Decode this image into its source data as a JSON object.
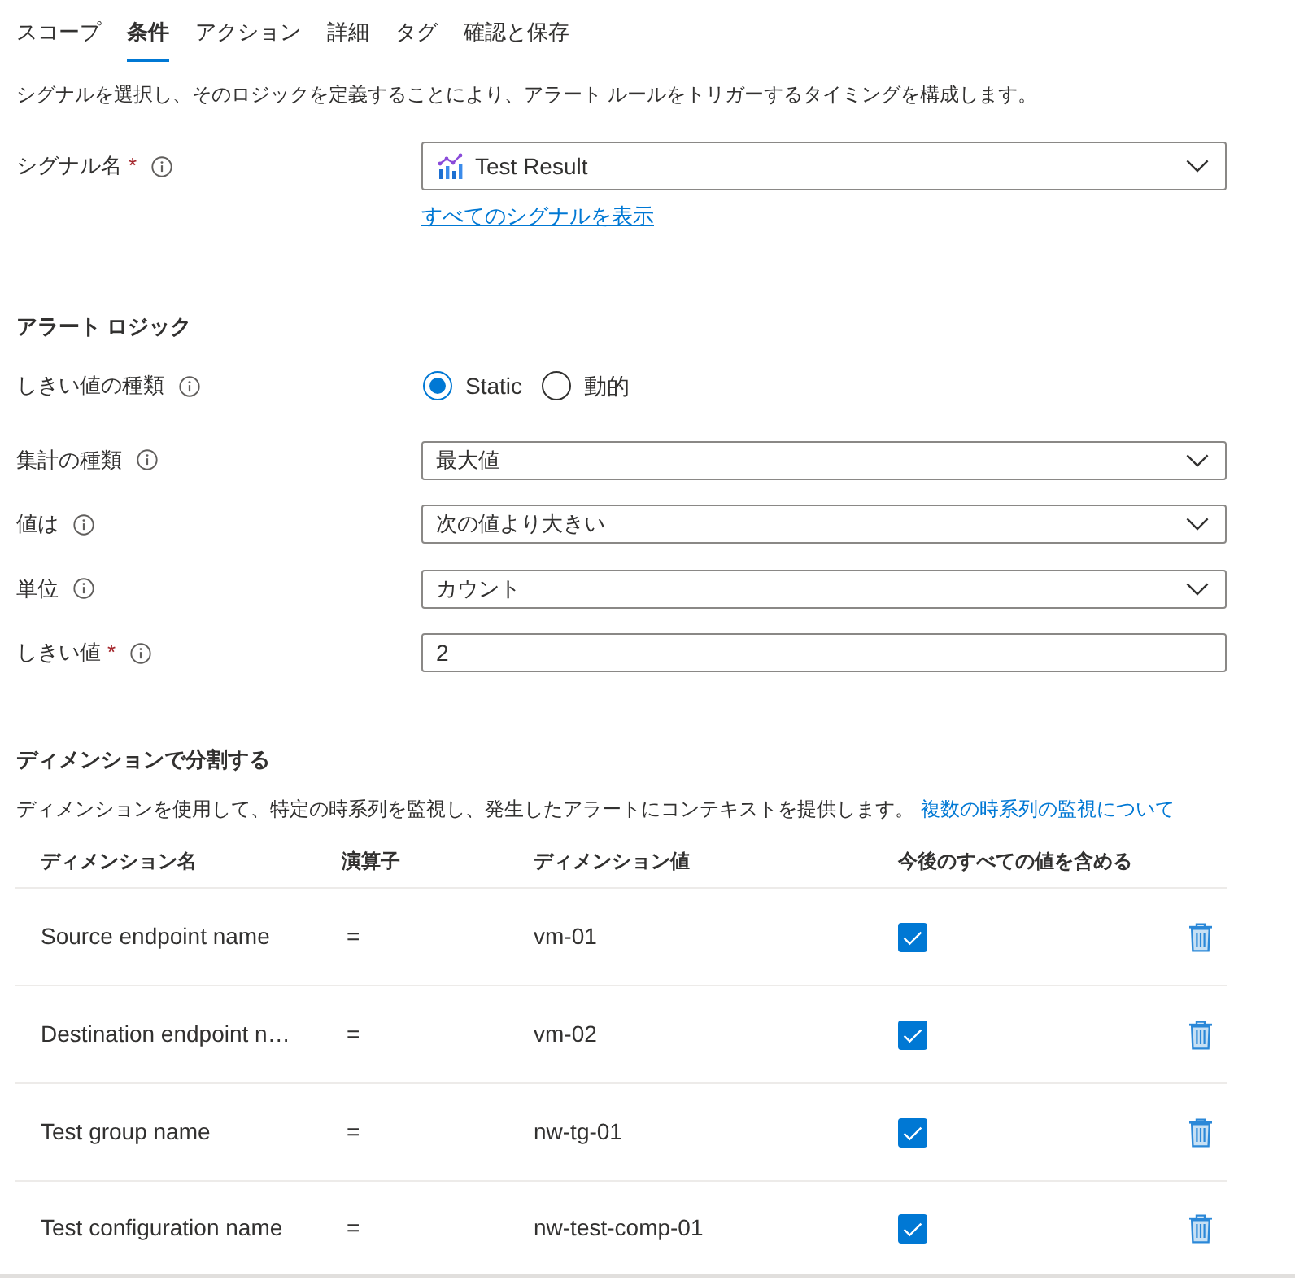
{
  "tabs": [
    {
      "label": "スコープ",
      "selected": false
    },
    {
      "label": "条件",
      "selected": true
    },
    {
      "label": "アクション",
      "selected": false
    },
    {
      "label": "詳細",
      "selected": false
    },
    {
      "label": "タグ",
      "selected": false
    },
    {
      "label": "確認と保存",
      "selected": false
    }
  ],
  "description": "シグナルを選択し、そのロジックを定義することにより、アラート ルールをトリガーするタイミングを構成します。",
  "signal": {
    "label": "シグナル名",
    "required_mark": "*",
    "value": "Test Result",
    "link": "すべてのシグナルを表示"
  },
  "alert_logic": {
    "heading": "アラート ロジック",
    "fields": [
      {
        "kind": "radio",
        "label": "しきい値の種類",
        "options": [
          {
            "label": "Static",
            "selected": true
          },
          {
            "label": "動的",
            "selected": false
          }
        ]
      },
      {
        "kind": "select",
        "label": "集計の種類",
        "value": "最大値"
      },
      {
        "kind": "select",
        "label": "値は",
        "value": "次の値より大きい"
      },
      {
        "kind": "select",
        "label": "単位",
        "value": "カウント"
      },
      {
        "kind": "input",
        "label": "しきい値",
        "required_mark": "*",
        "value": "2"
      }
    ]
  },
  "dimensions": {
    "heading": "ディメンションで分割する",
    "description": "ディメンションを使用して、特定の時系列を監視し、発生したアラートにコンテキストを提供します。",
    "link": "複数の時系列の監視について",
    "columns": [
      "ディメンション名",
      "演算子",
      "ディメンション値",
      "今後のすべての値を含める"
    ],
    "rows": [
      {
        "name": "Source endpoint name",
        "operator": "=",
        "value": "vm-01",
        "checked": true
      },
      {
        "name": "Destination endpoint n…",
        "operator": "=",
        "value": "vm-02",
        "checked": true
      },
      {
        "name": "Test group name",
        "operator": "=",
        "value": "nw-tg-01",
        "checked": true
      },
      {
        "name": "Test configuration name",
        "operator": "=",
        "value": "nw-test-comp-01",
        "checked": true
      }
    ]
  }
}
